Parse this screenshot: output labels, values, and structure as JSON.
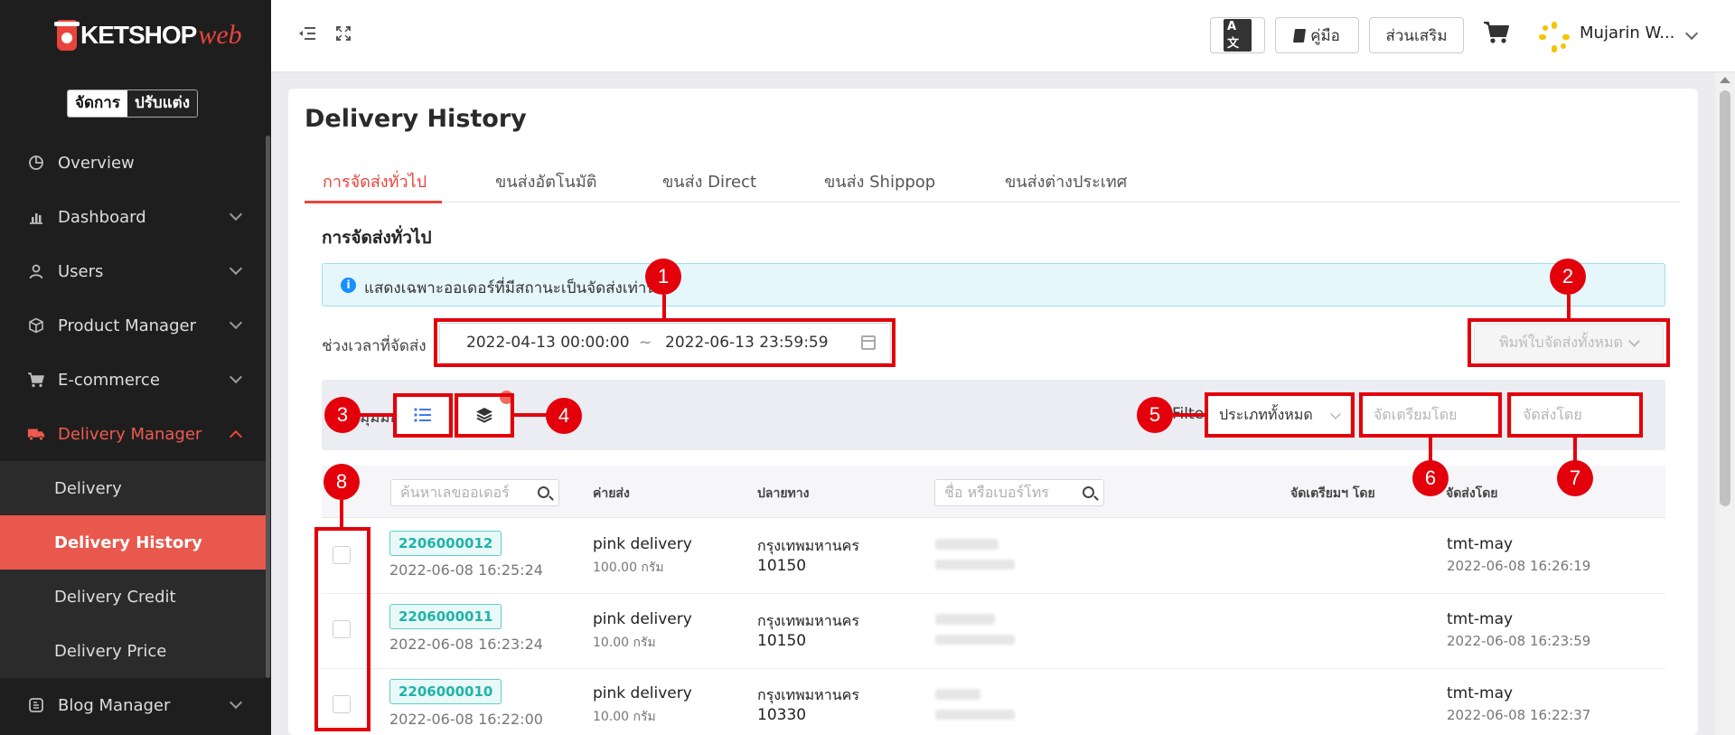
{
  "sidebar": {
    "brand": "KETSHOP",
    "brand_suffix": "web",
    "mode_active": "จัดการ",
    "mode_inactive": "ปรับแต่ง",
    "items": [
      {
        "label": "Overview",
        "icon": "pie-chart-icon"
      },
      {
        "label": "Dashboard",
        "icon": "bar-chart-icon"
      },
      {
        "label": "Users",
        "icon": "user-icon"
      },
      {
        "label": "Product Manager",
        "icon": "box-icon"
      },
      {
        "label": "E-commerce",
        "icon": "cart-icon"
      },
      {
        "label": "Delivery Manager",
        "icon": "truck-icon"
      }
    ],
    "sub_items": [
      "Delivery",
      "Delivery History",
      "Delivery Credit",
      "Delivery Price"
    ],
    "last_item": {
      "label": "Blog Manager",
      "icon": "blog-icon"
    }
  },
  "topbar": {
    "lang_label": "A文",
    "manual_label": "คู่มือ",
    "addon_label": "ส่วนเสริม",
    "user_name": "Mujarin W..."
  },
  "page": {
    "title": "Delivery History",
    "tabs": [
      "การจัดส่งทั่วไป",
      "ขนส่งอัตโนมัติ",
      "ขนส่ง Direct",
      "ขนส่ง Shippop",
      "ขนส่งต่างประเทศ"
    ],
    "section_title": "การจัดส่งทั่วไป",
    "alert_text": "แสดงเฉพาะออเดอร์ที่มีสถานะเป็นจัดส่งเท่านั้น",
    "range_label": "ช่วงเวลาที่จัดส่ง",
    "range_start": "2022-04-13 00:00:00",
    "range_sep": "~",
    "range_end": "2022-06-13 23:59:59",
    "print_all": "พิมพ์ใบจัดส่งทั้งหมด",
    "show_label": "มุมมอง",
    "filter_label": "Filter",
    "type_select": "ประเภททั้งหมด",
    "prepared_by_placeholder": "จัดเตรียมโดย",
    "shipped_by_placeholder": "จัดส่งโดย"
  },
  "table": {
    "order_search_placeholder": "ค้นหาเลขออเดอร์",
    "name_search_placeholder": "ชื่อ หรือเบอร์โทร",
    "headers": {
      "shipping_cost": "ค่ายส่ง",
      "destination": "ปลายทาง",
      "prepared_by": "จัดเตรียมฯ โดย",
      "shipped_by": "จัดส่งโดย"
    },
    "rows": [
      {
        "order": "2206000012",
        "order_time": "2022-06-08 16:25:24",
        "carrier": "pink delivery",
        "weight": "100.00 กรัม",
        "city": "กรุงเทพมหานคร",
        "zip": "10150",
        "shipper": "tmt-may",
        "ship_time": "2022-06-08 16:26:19"
      },
      {
        "order": "2206000011",
        "order_time": "2022-06-08 16:23:24",
        "carrier": "pink delivery",
        "weight": "10.00 กรัม",
        "city": "กรุงเทพมหานคร",
        "zip": "10150",
        "shipper": "tmt-may",
        "ship_time": "2022-06-08 16:23:59"
      },
      {
        "order": "2206000010",
        "order_time": "2022-06-08 16:22:00",
        "carrier": "pink delivery",
        "weight": "10.00 กรัม",
        "city": "กรุงเทพมหานคร",
        "zip": "10330",
        "shipper": "tmt-may",
        "ship_time": "2022-06-08 16:22:37"
      }
    ]
  },
  "annotations": [
    "1",
    "2",
    "3",
    "4",
    "5",
    "6",
    "7",
    "8"
  ],
  "colors": {
    "accent": "#e9443c",
    "annotation": "#e3000b",
    "order_tag": "#1fb3a9",
    "sidebar_bg": "#1e1e1e"
  }
}
